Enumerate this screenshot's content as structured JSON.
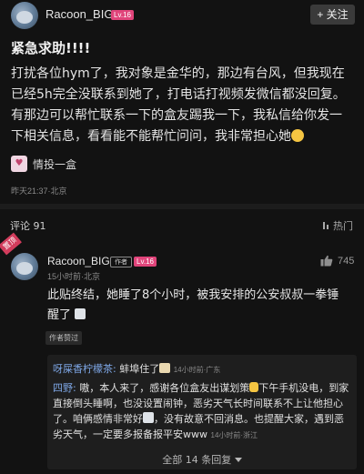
{
  "post": {
    "username": "Racoon_BIG",
    "level": "Lv.16",
    "follow_label": "+ 关注",
    "title": "紧急求助!!!!",
    "body_lines": [
      "打扰各位hym了，我对象是金华的，那边有台风，但我现在",
      "已经5h完全没联系到她了，打电话打视频发微信都没回复。",
      "有那边可以帮忙联系一下的盒友踢我一下，我私信给你发一",
      "下相关信息，看看能不能帮忙问问，我非常担心她"
    ],
    "topic": "情投一盒",
    "meta": "昨天21:37·北京"
  },
  "comments_bar": {
    "label": "评论",
    "count": "91",
    "sort_label": "热门"
  },
  "pinned_comment": {
    "pin_label": "置顶",
    "username": "Racoon_BIG",
    "author_tag": "作者",
    "level": "Lv.16",
    "meta": "15小时前·北京",
    "like_count": "745",
    "body_line1": "此贴终结，她睡了8个小时，被我安排的公安叔叔一拳锤",
    "body_line2": "醒了",
    "liked_tag": "作者赞过",
    "replies": {
      "r1_name": "呀屎香柠檬茶:",
      "r1_text": "蚌埠住了",
      "r1_time": "14小时前·广东",
      "r2_name": "四野:",
      "r2_text_a": "嗷，本人来了，感谢各位盒友出谋划策",
      "r2_text_b": "下午手机没电，到家直接倒头睡啊，也没设置闹钟，恶劣天气长时间联系不上让他担心了。咱俩感情非常好",
      "r2_text_c": "，没有故意不回消息。也提醒大家，遇到恶劣天气，一定要多报备报平安www",
      "r2_time": "14小时前·浙江",
      "show_all": "全部 14 条回复"
    }
  },
  "colors": {
    "background": "#121212",
    "accent_pink": "#e0447a",
    "reply_name_blue": "#7ea7e6"
  },
  "icons": [
    "avatar",
    "level-badge",
    "topic-icon",
    "sort-icon",
    "like-icon",
    "chevron-down-icon"
  ]
}
